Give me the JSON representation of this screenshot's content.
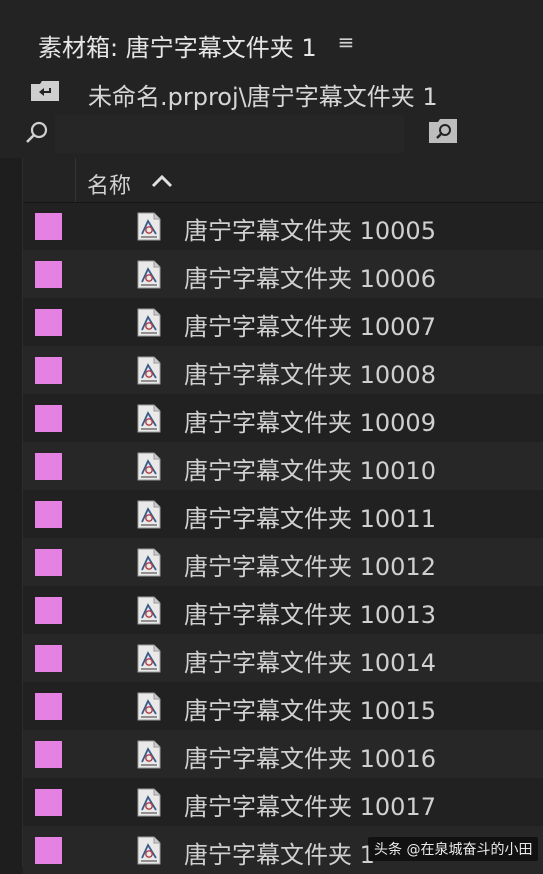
{
  "panel": {
    "title": "素材箱: 唐宁字幕文件夹 1",
    "menu_icon": "hamburger-icon",
    "path": "未命名.prproj\\唐宁字幕文件夹 1",
    "search": {
      "value": "",
      "placeholder": ""
    }
  },
  "list": {
    "column_header": "名称",
    "sort": "ascending",
    "label_color": "#e581e3",
    "rows": [
      {
        "name": "唐宁字幕文件夹 10005"
      },
      {
        "name": "唐宁字幕文件夹 10006"
      },
      {
        "name": "唐宁字幕文件夹 10007"
      },
      {
        "name": "唐宁字幕文件夹 10008"
      },
      {
        "name": "唐宁字幕文件夹 10009"
      },
      {
        "name": "唐宁字幕文件夹 10010"
      },
      {
        "name": "唐宁字幕文件夹 10011"
      },
      {
        "name": "唐宁字幕文件夹 10012"
      },
      {
        "name": "唐宁字幕文件夹 10013"
      },
      {
        "name": "唐宁字幕文件夹 10014"
      },
      {
        "name": "唐宁字幕文件夹 10015"
      },
      {
        "name": "唐宁字幕文件夹 10016"
      },
      {
        "name": "唐宁字幕文件夹 10017"
      },
      {
        "name": "唐宁字幕文件夹 1"
      }
    ]
  },
  "watermark": "头条 @在泉城奋斗的小田"
}
